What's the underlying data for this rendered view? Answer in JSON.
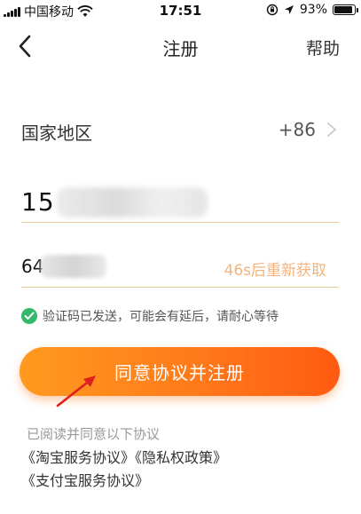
{
  "status_bar": {
    "carrier": "中国移动",
    "time": "17:51",
    "battery": "93%",
    "battery_level": 0.93,
    "icons": [
      "signal-icon",
      "wifi-icon",
      "rotation-lock-icon",
      "location-icon",
      "battery-icon"
    ]
  },
  "nav": {
    "back_icon": "chevron-left-icon",
    "title": "注册",
    "help": "帮助"
  },
  "form": {
    "country_label": "国家地区",
    "country_code": "+86",
    "phone_value_visible": "15",
    "code_value_visible": "64",
    "resend_label": "46s后重新获取"
  },
  "hint": {
    "icon": "check-circle-icon",
    "text": "验证码已发送，可能会有延后，请耐心等待"
  },
  "register_button": {
    "label": "同意协议并注册"
  },
  "agreements": {
    "intro": "已阅读并同意以下协议",
    "links": [
      "《淘宝服务协议》",
      "《隐私权政策》",
      "《支付宝服务协议》"
    ]
  },
  "colors": {
    "accent_orange": "#ff7a1a",
    "resend_orange": "#f5b27a",
    "check_green": "#34b86a",
    "underline": "#e8c99a",
    "annotation_arrow": "#e02020"
  }
}
